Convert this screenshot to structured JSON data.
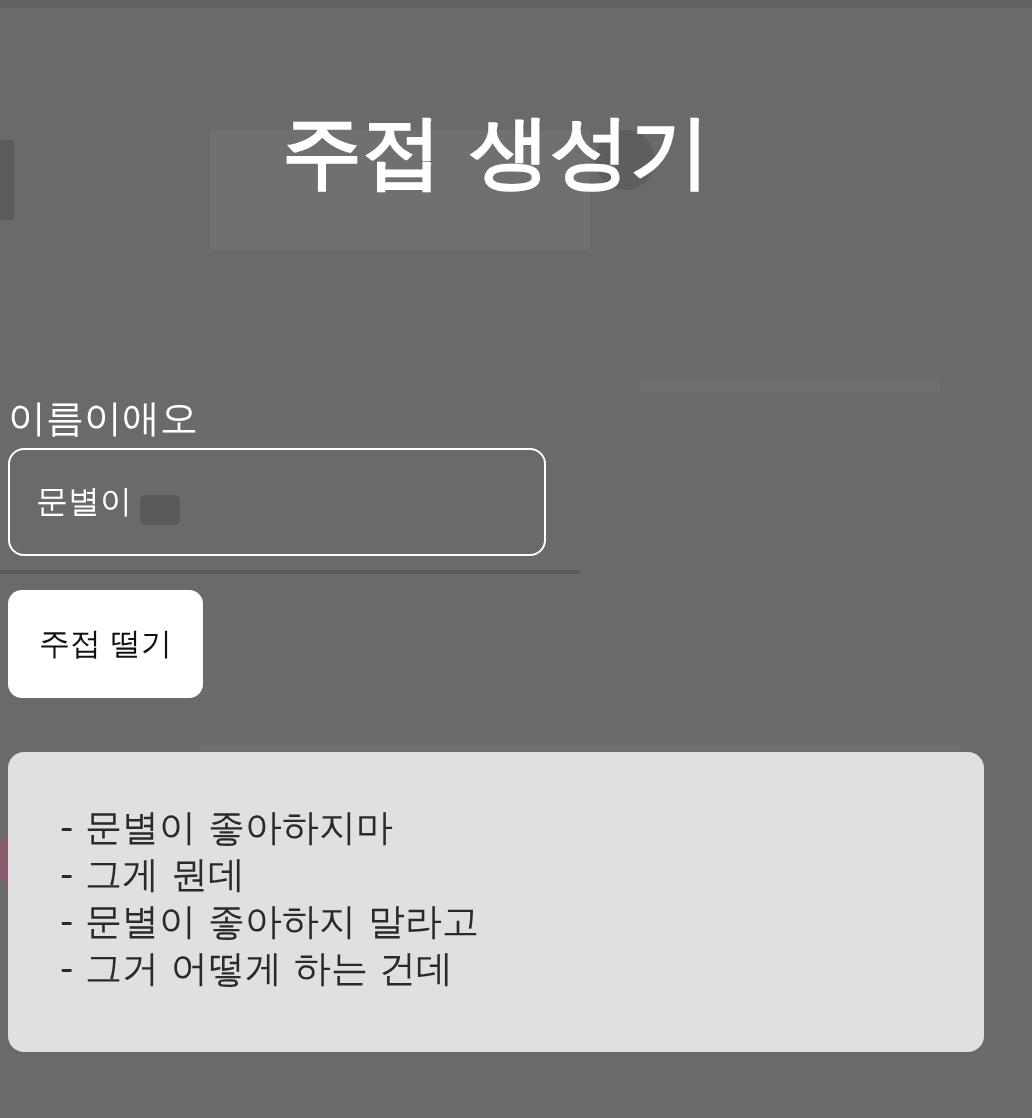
{
  "title": "주접 생성기",
  "name_field": {
    "label": "이름이애오",
    "value": "문별이"
  },
  "button": "주접 떨기",
  "result_lines": [
    "- 문별이 좋아하지마",
    "- 그게 뭔데",
    "- 문별이 좋아하지 말라고",
    "- 그거 어떻게 하는 건데"
  ]
}
